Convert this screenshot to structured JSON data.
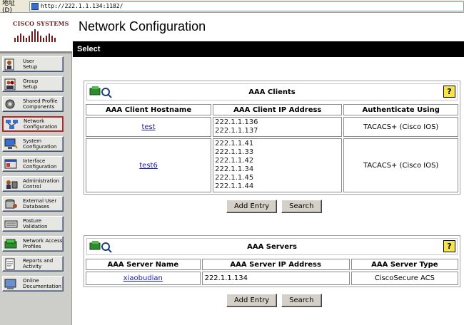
{
  "browser": {
    "address_label": "地址(D)",
    "url": "http://222.1.1.134:1182/"
  },
  "logo": {
    "text": "Cisco Systems"
  },
  "sidebar": {
    "items": [
      {
        "label": "User\nSetup",
        "icon": "user-setup-icon"
      },
      {
        "label": "Group\nSetup",
        "icon": "group-setup-icon"
      },
      {
        "label": "Shared Profile\nComponents",
        "icon": "shared-profile-icon"
      },
      {
        "label": "Network\nConfiguration",
        "icon": "network-config-icon",
        "active": true
      },
      {
        "label": "System\nConfiguration",
        "icon": "system-config-icon"
      },
      {
        "label": "Interface\nConfiguration",
        "icon": "interface-config-icon"
      },
      {
        "label": "Administration\nControl",
        "icon": "admin-control-icon"
      },
      {
        "label": "External User\nDatabases",
        "icon": "external-db-icon"
      },
      {
        "label": "Posture\nValidation",
        "icon": "posture-validation-icon"
      },
      {
        "label": "Network Access\nProfiles",
        "icon": "network-access-icon"
      },
      {
        "label": "Reports and\nActivity",
        "icon": "reports-icon"
      },
      {
        "label": "Online\nDocumentation",
        "icon": "documentation-icon"
      }
    ]
  },
  "header": {
    "title": "Network Configuration",
    "section": "Select"
  },
  "aaa_clients": {
    "caption": "AAA Clients",
    "help": "?",
    "columns": [
      "AAA Client Hostname",
      "AAA Client IP Address",
      "Authenticate Using"
    ],
    "rows": [
      {
        "hostname": "test",
        "ips": "222.1.1.136\n222.1.1.137",
        "auth": "TACACS+ (Cisco IOS)"
      },
      {
        "hostname": "test6",
        "ips": "222.1.1.41\n222.1.1.33\n222.1.1.42\n222.1.1.34\n222.1.1.45\n222.1.1.44",
        "auth": "TACACS+ (Cisco IOS)"
      }
    ],
    "add_label": "Add Entry",
    "search_label": "Search"
  },
  "aaa_servers": {
    "caption": "AAA Servers",
    "help": "?",
    "columns": [
      "AAA Server Name",
      "AAA Server IP Address",
      "AAA Server Type"
    ],
    "rows": [
      {
        "name": "xiaobudian",
        "ip": "222.1.1.134",
        "type": "CiscoSecure ACS"
      }
    ],
    "add_label": "Add Entry",
    "search_label": "Search"
  },
  "colors": {
    "selectbar": "#000000",
    "sidebar": "#cdcdc9",
    "active_border": "#b32828",
    "help": "#f6e54a",
    "link": "#1a1aa8"
  }
}
